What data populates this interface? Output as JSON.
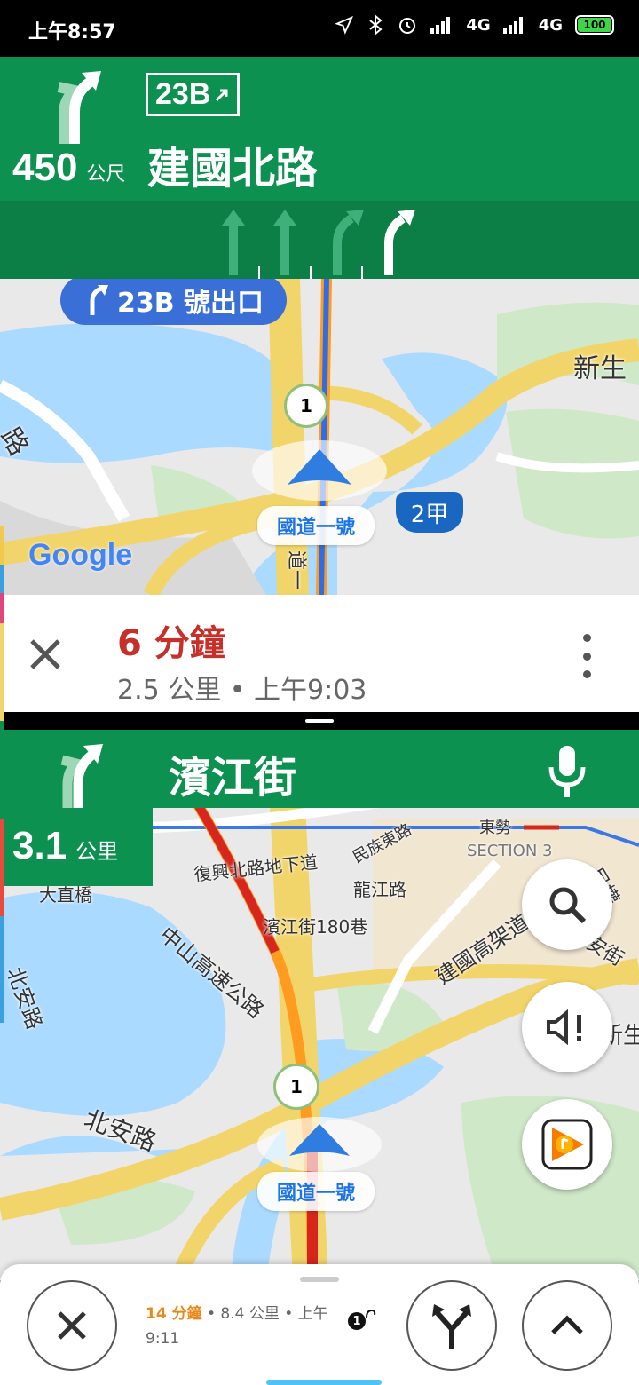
{
  "status": {
    "time": "上午8:57",
    "network1": "4G",
    "network2": "4G",
    "battery": "100"
  },
  "app_top": {
    "nav": {
      "distance_value": "450",
      "distance_unit": "公尺",
      "exit_badge": "23B",
      "street": "建國北路"
    },
    "map": {
      "callout": "23B 號出口",
      "road_label_1": "新生",
      "road_label_2": "路",
      "route_shield_1": "1",
      "shield_2": "2甲",
      "highway_name": "國道一號",
      "vertical_label": "道一",
      "google_logo": "Google"
    },
    "eta": {
      "minutes": "6 分鐘",
      "details": "2.5 公里 • 上午9:03"
    }
  },
  "app_bottom": {
    "nav": {
      "street": "濱江街",
      "distance_value": "3.1",
      "distance_unit": "公里"
    },
    "map": {
      "labels": {
        "dongshi": "東勢",
        "section3": "SECTION 3",
        "minzu": "民族東路",
        "fuxing": "復興北路地下道",
        "dazhi": "大直橋",
        "longjiang": "龍江路",
        "binjiang180": "濱江街180巷",
        "zhongshan": "中山高速公路",
        "jianguo": "建國高架道",
        "nongan": "農安街",
        "minquan": "民權",
        "beian1": "北安路",
        "beian2": "北安路",
        "xinsheng": "新生"
      },
      "route_shield": "1",
      "highway_name": "國道一號"
    },
    "bottom_bar": {
      "minutes": "14 分鐘",
      "details": " • 8.4 公里 • 上午9:11",
      "shield_num": "1"
    }
  }
}
